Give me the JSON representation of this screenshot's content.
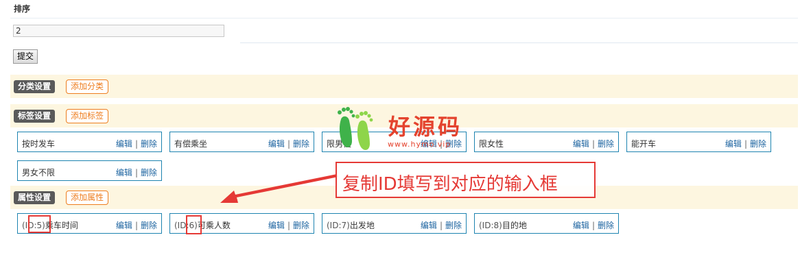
{
  "sort": {
    "label": "排序",
    "value": "2",
    "submit_label": "提交"
  },
  "category": {
    "title": "分类设置",
    "add_label": "添加分类"
  },
  "tags": {
    "title": "标签设置",
    "add_label": "添加标签",
    "items": [
      {
        "name": "按时发车"
      },
      {
        "name": "有偿乘坐"
      },
      {
        "name": "限男性"
      },
      {
        "name": "限女性"
      },
      {
        "name": "能开车"
      },
      {
        "name": "男女不限"
      }
    ]
  },
  "attributes": {
    "title": "属性设置",
    "add_label": "添加属性",
    "items": [
      {
        "id_label": "(ID:5)",
        "name": "乘车时间"
      },
      {
        "id_label": "(ID:6)",
        "name": "可乘人数"
      },
      {
        "id_label": "(ID:7)",
        "name": "出发地"
      },
      {
        "id_label": "(ID:8)",
        "name": "目的地"
      }
    ]
  },
  "actions": {
    "edit": "编辑",
    "sep": "|",
    "delete": "删除"
  },
  "watermark": {
    "text": "好源码",
    "url": "www.hymo.vip"
  },
  "annotation": {
    "text": "复制ID填写到对应的输入框",
    "color": "#e53935"
  }
}
